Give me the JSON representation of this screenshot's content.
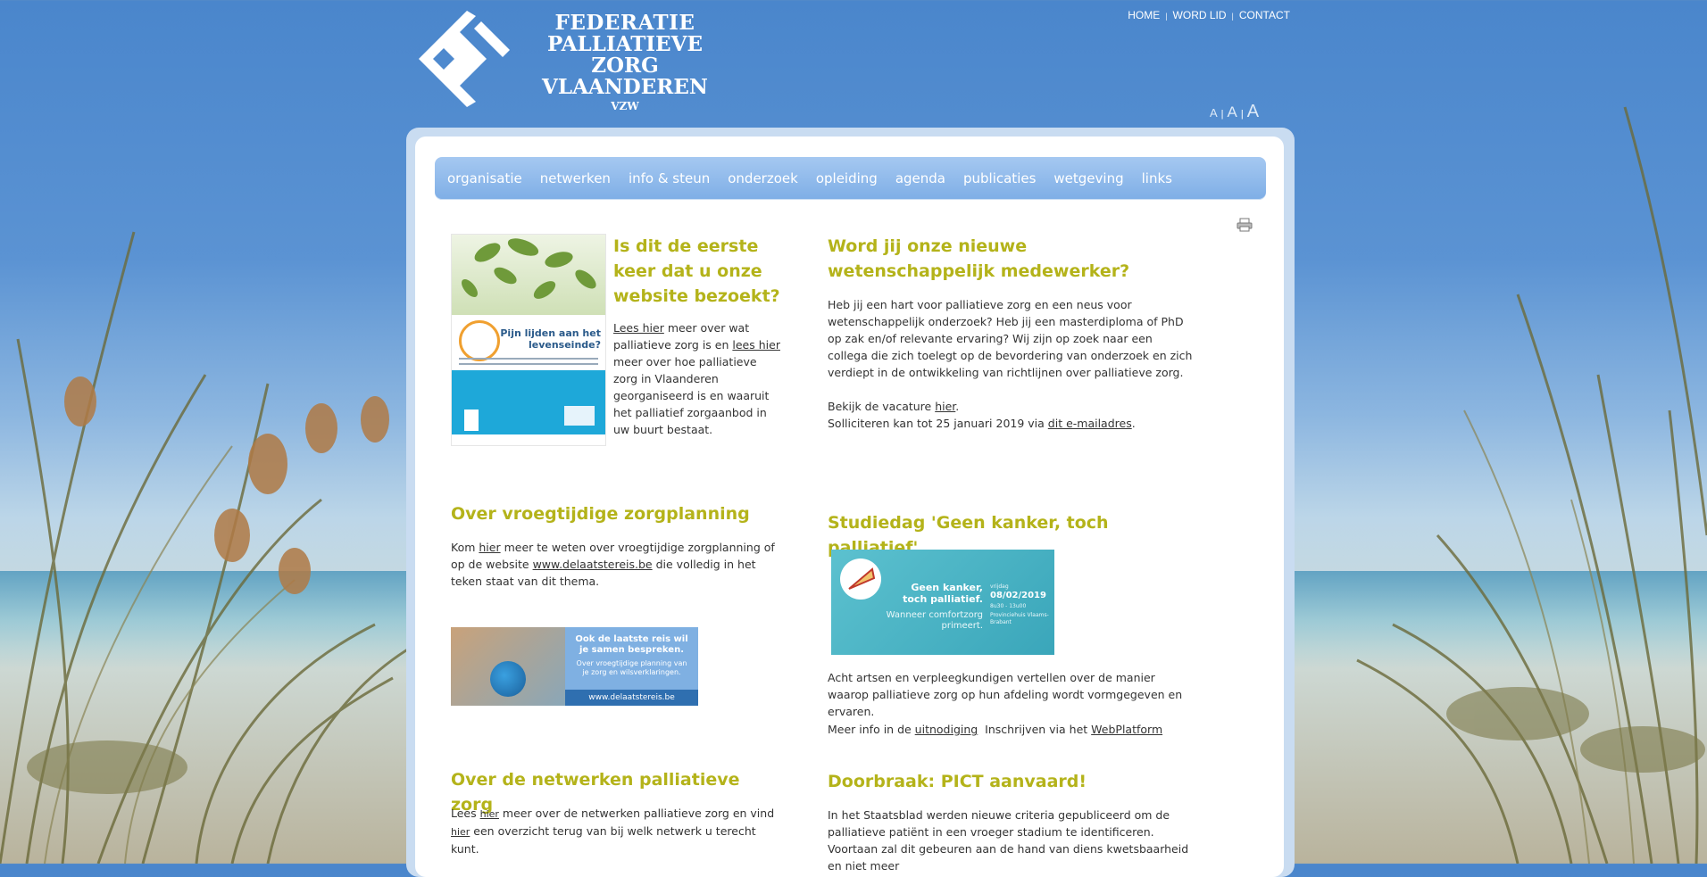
{
  "header": {
    "logo_lines": [
      "FEDERATIE",
      "PALLIATIEVE ZORG",
      "VLAANDEREN",
      "VZW"
    ],
    "top_links": [
      "HOME",
      "WORD LID",
      "CONTACT"
    ],
    "separator": "|",
    "font_sizes": [
      "A",
      "A",
      "A"
    ]
  },
  "nav": {
    "items": [
      "organisatie",
      "netwerken",
      "info & steun",
      "onderzoek",
      "opleiding",
      "agenda",
      "publicaties",
      "wetgeving",
      "links"
    ]
  },
  "left": {
    "intro": {
      "title": "Is dit de eerste keer dat u onze website bezoekt?",
      "poster_heading": "Pijn lijden aan het levenseinde?",
      "link1": "Lees hier",
      "text1": " meer over wat palliatieve zorg is en ",
      "link2": "lees hier",
      "text2": " meer over hoe palliatieve zorg in Vlaanderen georganiseerd is en waaruit het palliatief zorgaanbod in uw buurt bestaat."
    },
    "vroeg": {
      "title": "Over vroegtijdige zorgplanning",
      "t1": "Kom ",
      "link1": "hier",
      "t2": " meer te weten over vroegtijdige zorgplanning of op de website ",
      "link2": "www.delaatstereis.be",
      "t3": " die volledig in het teken staat van dit thema.",
      "banner_title": "Ook de laatste reis wil je samen bespreken.",
      "banner_sub": "Over vroegtijdige planning van je zorg en wilsverklaringen.",
      "banner_url": "www.delaatstereis.be"
    },
    "netwerken": {
      "title": "Over de netwerken palliatieve zorg",
      "t1": "Lees ",
      "link1": "hier",
      "t2": " meer over de netwerken palliatieve zorg en vind ",
      "link2": "hier",
      "t3": " een overzicht terug van bij welk netwerk u terecht kunt."
    }
  },
  "right": {
    "job": {
      "title": "Word jij onze nieuwe wetenschappelijk medewerker?",
      "text": "Heb jij een hart voor palliatieve zorg en een neus voor wetenschappelijk onderzoek? Heb jij een masterdiploma of PhD op zak en/of relevante ervaring? Wij zijn op zoek naar een collega die zich toelegt op de bevordering van onderzoek en zich verdiept in de ontwikkeling van richtlijnen over palliatieve zorg.",
      "t1": "Bekijk de vacature ",
      "link1": "hier",
      "t2": ".",
      "t3": "Solliciteren kan tot 25 januari 2019 via ",
      "link2": "dit e-mailadres",
      "t4": "."
    },
    "studiedag": {
      "title": "Studiedag 'Geen kanker, toch palliatief'",
      "banner_title": "Geen kanker, toch palliatief.",
      "banner_sub": "Wanneer comfortzorg primeert.",
      "banner_day": "vrijdag",
      "banner_date": "08/02/2019",
      "banner_time": "8u30 - 13u00",
      "banner_place": "Provinciehuis Vlaams-Brabant",
      "text": "Acht artsen en verpleegkundigen vertellen over de manier waarop palliatieve zorg op hun afdeling wordt vormgegeven en ervaren.",
      "t1": "Meer info in de ",
      "link1": "uitnodiging",
      "t2": "  Inschrijven via het ",
      "link2": "WebPlatform"
    },
    "pict": {
      "title": "Doorbraak: PICT aanvaard!",
      "text": "In het Staatsblad werden nieuwe criteria gepubliceerd om de palliatieve patiënt in een vroeger stadium te identificeren. Voortaan zal dit gebeuren aan de hand van diens kwetsbaarheid en niet meer"
    }
  },
  "colors": {
    "accent": "#b4b31a",
    "nav_top": "#a5c8f1",
    "nav_bottom": "#7eaee6",
    "sky": "#4a86cc"
  }
}
